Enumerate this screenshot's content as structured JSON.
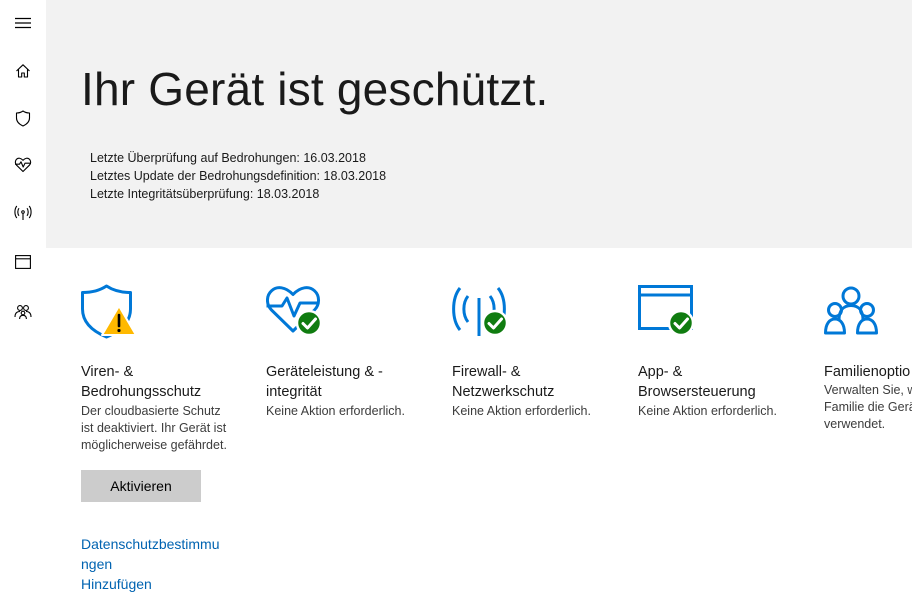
{
  "colors": {
    "accent": "#0078d7",
    "ok": "#107c10",
    "warn": "#ffb900",
    "link": "#0063b1"
  },
  "sidebar": {
    "items": [
      {
        "name": "menu",
        "icon": "hamburger-menu-icon"
      },
      {
        "name": "home",
        "icon": "home-icon"
      },
      {
        "name": "virus-protection",
        "icon": "shield-icon"
      },
      {
        "name": "device-health",
        "icon": "heart-pulse-icon"
      },
      {
        "name": "firewall",
        "icon": "antenna-icon"
      },
      {
        "name": "app-browser",
        "icon": "browser-window-icon"
      },
      {
        "name": "family",
        "icon": "family-icon"
      }
    ]
  },
  "hero": {
    "title": "Ihr Gerät ist geschützt.",
    "status_lines": [
      "Letzte Überprüfung auf Bedrohungen: 16.03.2018",
      "Letztes Update der Bedrohungsdefinition: 18.03.2018",
      "Letzte Integritätsüberprüfung: 18.03.2018"
    ]
  },
  "tiles": [
    {
      "title_lines": [
        "Viren- &",
        "Bedrohungsschutz"
      ],
      "desc_lines": [
        "Der cloudbasierte Schutz",
        "ist deaktiviert. Ihr Gerät ist",
        "möglicherweise gefährdet."
      ],
      "icon": "shield-warning-icon",
      "status": "warning"
    },
    {
      "title_lines": [
        "Geräteleistung & -",
        "integrität"
      ],
      "desc_lines": [
        "Keine Aktion erforderlich."
      ],
      "icon": "heart-pulse-check-icon",
      "status": "ok"
    },
    {
      "title_lines": [
        "Firewall- &",
        "Netzwerkschutz"
      ],
      "desc_lines": [
        "Keine Aktion erforderlich."
      ],
      "icon": "antenna-check-icon",
      "status": "ok"
    },
    {
      "title_lines": [
        "App- &",
        "Browsersteuerung"
      ],
      "desc_lines": [
        "Keine Aktion erforderlich."
      ],
      "icon": "browser-check-icon",
      "status": "ok"
    },
    {
      "title_lines": [
        "Familienoptio"
      ],
      "desc_lines": [
        "Verwalten Sie, w",
        "Familie die Gerä",
        "verwendet."
      ],
      "icon": "family-icon",
      "status": "none"
    }
  ],
  "activate_button": {
    "label": "Aktivieren"
  },
  "links": {
    "privacy_line1": "Datenschutzbestimmu",
    "privacy_line2": "ngen",
    "add": "Hinzufügen"
  }
}
